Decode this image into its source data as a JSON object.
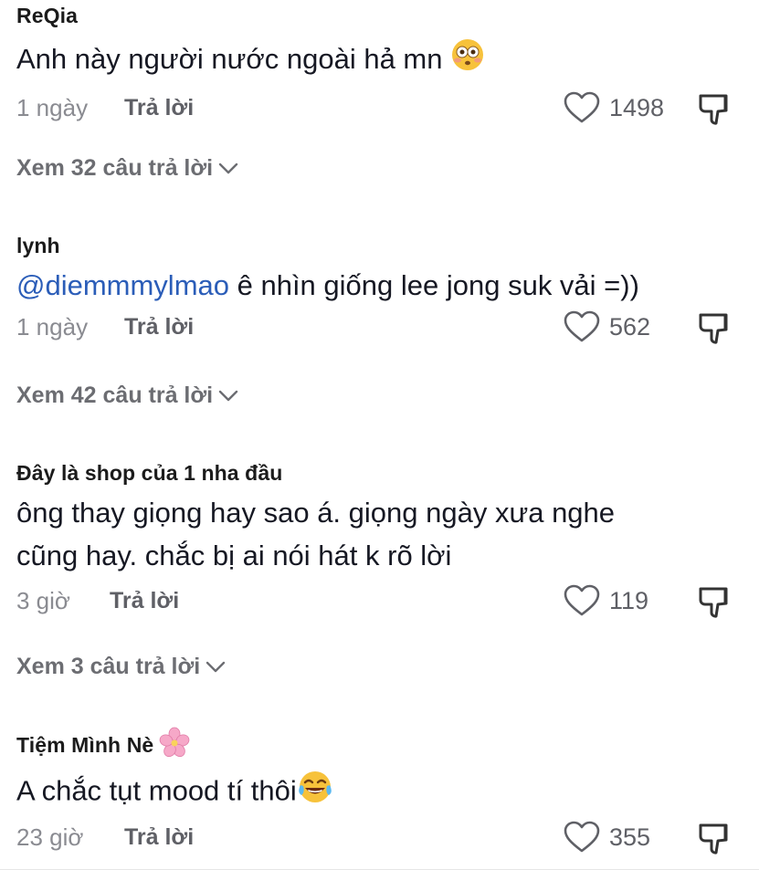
{
  "comments": [
    {
      "username": "ReQia",
      "text": "Anh này người nước ngoài hả mn",
      "time": "1 ngày",
      "reply_label": "Trả lời",
      "likes": "1498",
      "view_replies": "Xem 32 câu trả lời"
    },
    {
      "username": "lynh",
      "mention": "@diemmmylmao",
      "text": " ê nhìn giống lee jong suk vải =))",
      "time": "1 ngày",
      "reply_label": "Trả lời",
      "likes": "562",
      "view_replies": "Xem 42 câu trả lời"
    },
    {
      "username": "Đây là shop của 1 nha đầu",
      "text_line1": "ông thay giọng hay sao á. giọng ngày xưa nghe",
      "text_line2": "cũng hay. chắc bị ai nói hát k rõ lời",
      "time": "3 giờ",
      "reply_label": "Trả lời",
      "likes": "119",
      "view_replies": "Xem 3 câu trả lời"
    },
    {
      "username": "Tiệm Mình Nè",
      "text": "A chắc tụt mood tí thôi",
      "time": "23 giờ",
      "reply_label": "Trả lời",
      "likes": "355"
    }
  ],
  "icons": {
    "like": "heart-outline-icon",
    "dislike": "thumbs-down-icon",
    "expand": "chevron-down-icon",
    "emoji_1": "flushed-face-emoji",
    "emoji_2": "cherry-blossom-emoji",
    "emoji_3": "tears-of-joy-emoji"
  },
  "colors": {
    "mention": "#2b5db8",
    "meta": "#8a8b91",
    "text": "#161823"
  }
}
